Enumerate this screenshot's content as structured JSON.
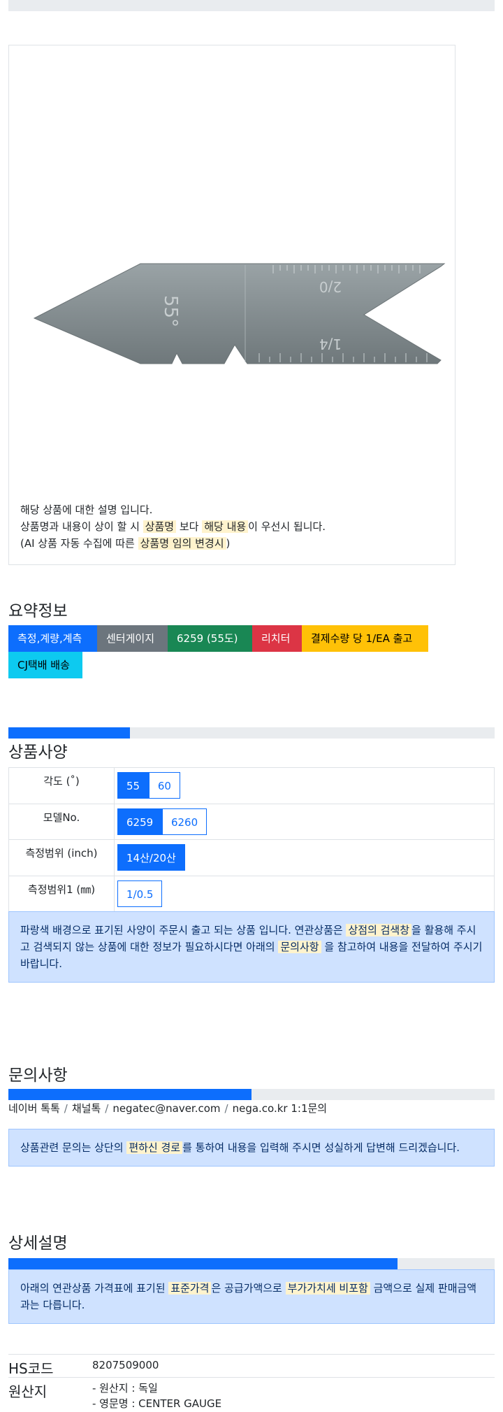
{
  "product": {
    "description_lines": [
      {
        "parts": [
          "해당 상품에 대한 설명 입니다."
        ]
      },
      {
        "parts": [
          "상품명과 내용이 상이 할 시 ",
          "상품명",
          " 보다 ",
          "해당 내용",
          "이 우선시 됩니다."
        ]
      },
      {
        "parts": [
          "(AI 상품 자동 수집에 따른 ",
          "상품명 임의 변경시",
          ")"
        ]
      }
    ],
    "gauge_marks": {
      "angle": "55°",
      "scale_a": "2/0",
      "scale_b": "1/4"
    }
  },
  "summary": {
    "title": "요약정보",
    "chips": [
      {
        "label": "측정,계량,계측",
        "color": "#0d6efd",
        "text_color": "#ffffff"
      },
      {
        "label": "센터게이지",
        "color": "#6c757d",
        "text_color": "#ffffff"
      },
      {
        "label": "6259 (55도)",
        "color": "#198754",
        "text_color": "#ffffff"
      },
      {
        "label": "리치터",
        "color": "#dc3545",
        "text_color": "#ffffff"
      },
      {
        "label": "결제수량 당 1/EA 출고",
        "color": "#ffc107",
        "text_color": "#000000"
      },
      {
        "label": "CJ택배 배송",
        "color": "#0dcaf0",
        "text_color": "#000000"
      }
    ]
  },
  "specs": {
    "title": "상품사양",
    "progress": 0.25,
    "rows": [
      {
        "label": "각도 (˚)",
        "options": [
          {
            "text": "55",
            "active": true
          },
          {
            "text": "60",
            "active": false
          }
        ]
      },
      {
        "label": "모델No.",
        "options": [
          {
            "text": "6259",
            "active": true
          },
          {
            "text": "6260",
            "active": false
          }
        ]
      },
      {
        "label": "측정범위 (inch)",
        "options": [
          {
            "text": "14산/20산",
            "active": true
          }
        ]
      },
      {
        "label": "측정범위1 (㎜)",
        "options": [
          {
            "text": "1/0.5",
            "active": false
          }
        ]
      }
    ],
    "notice": [
      "파랑색 배경으로 표기된 사양이 주문시 출고 되는 상품 입니다. 연관상품은 ",
      "상점의 검색창",
      "을 활용해 주시고 검색되지 않는 상품에 대한 정보가 필요하시다면 아래의 ",
      "문의사항",
      " 을 참고하여 내용을 전달하여 주시기 바랍니다."
    ]
  },
  "inquiry": {
    "title": "문의사항",
    "progress": 0.5,
    "contacts": [
      "네이버 톡톡",
      "채널톡",
      "negatec@naver.com",
      "nega.co.kr 1:1문의"
    ],
    "separator": "/",
    "notice": [
      "상품관련 문의는 상단의 ",
      "편하신 경로",
      "를 통하여 내용을 입력해 주시면 성실하게 답변해 드리겠습니다."
    ]
  },
  "detail": {
    "title": "상세설명",
    "progress": 0.8,
    "notice": [
      "아래의 연관상품 가격표에 표기된 ",
      "표준가격",
      "은 공급가액으로 ",
      "부가가치세 비포함",
      " 금액으로 실제 판매금액과는 다릅니다."
    ],
    "hs_label": "HS코드",
    "hs_value": "8207509000",
    "origin_label": "원산지",
    "origin_lines": [
      "- 원산지 : 독일",
      "- 영문명 : CENTER GAUGE"
    ]
  }
}
